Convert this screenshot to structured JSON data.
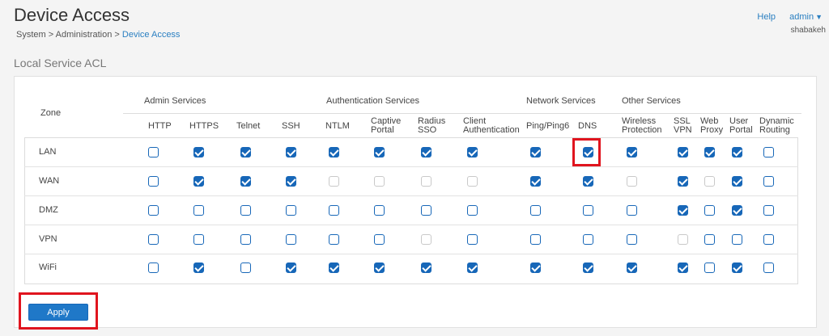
{
  "header": {
    "title": "Device Access",
    "breadcrumb": [
      "System",
      "Administration",
      "Device Access"
    ],
    "help": "Help",
    "user": "admin",
    "org": "shabakeh"
  },
  "section_title": "Local Service ACL",
  "table": {
    "zone_header": "Zone",
    "groups": [
      {
        "name": "Admin Services"
      },
      {
        "name": "Authentication Services"
      },
      {
        "name": "Network Services"
      },
      {
        "name": "Other Services"
      }
    ],
    "columns": [
      {
        "id": "http",
        "label": "HTTP"
      },
      {
        "id": "https",
        "label": "HTTPS"
      },
      {
        "id": "telnet",
        "label": "Telnet"
      },
      {
        "id": "ssh",
        "label": "SSH"
      },
      {
        "id": "ntlm",
        "label": "NTLM"
      },
      {
        "id": "captive",
        "label": "Captive\nPortal"
      },
      {
        "id": "radius",
        "label": "Radius\nSSO"
      },
      {
        "id": "clientauth",
        "label": "Client\nAuthentication"
      },
      {
        "id": "ping",
        "label": "Ping/Ping6"
      },
      {
        "id": "dns",
        "label": "DNS"
      },
      {
        "id": "wireless",
        "label": "Wireless\nProtection"
      },
      {
        "id": "sslvpn",
        "label": "SSL\nVPN"
      },
      {
        "id": "webproxy",
        "label": "Web\nProxy"
      },
      {
        "id": "userportal",
        "label": "User\nPortal"
      },
      {
        "id": "dynrouting",
        "label": "Dynamic\nRouting"
      }
    ],
    "rows": [
      {
        "zone": "LAN",
        "states": [
          "off",
          "on",
          "on",
          "on",
          "on",
          "on",
          "on",
          "on",
          "on",
          "on",
          "on",
          "on",
          "on",
          "on",
          "off"
        ]
      },
      {
        "zone": "WAN",
        "states": [
          "off",
          "on",
          "on",
          "on",
          "dis",
          "dis",
          "dis",
          "dis",
          "on",
          "on",
          "dis",
          "on",
          "dis",
          "on",
          "off"
        ]
      },
      {
        "zone": "DMZ",
        "states": [
          "off",
          "off",
          "off",
          "off",
          "off",
          "off",
          "off",
          "off",
          "off",
          "off",
          "off",
          "on",
          "off",
          "on",
          "off"
        ]
      },
      {
        "zone": "VPN",
        "states": [
          "off",
          "off",
          "off",
          "off",
          "off",
          "off",
          "dis",
          "off",
          "off",
          "off",
          "off",
          "dis",
          "off",
          "off",
          "off"
        ]
      },
      {
        "zone": "WiFi",
        "states": [
          "off",
          "on",
          "off",
          "on",
          "on",
          "on",
          "on",
          "on",
          "on",
          "on",
          "on",
          "on",
          "off",
          "on",
          "off"
        ]
      }
    ]
  },
  "apply_label": "Apply",
  "colors": {
    "accent": "#1767b8",
    "highlight": "#e0141e"
  }
}
